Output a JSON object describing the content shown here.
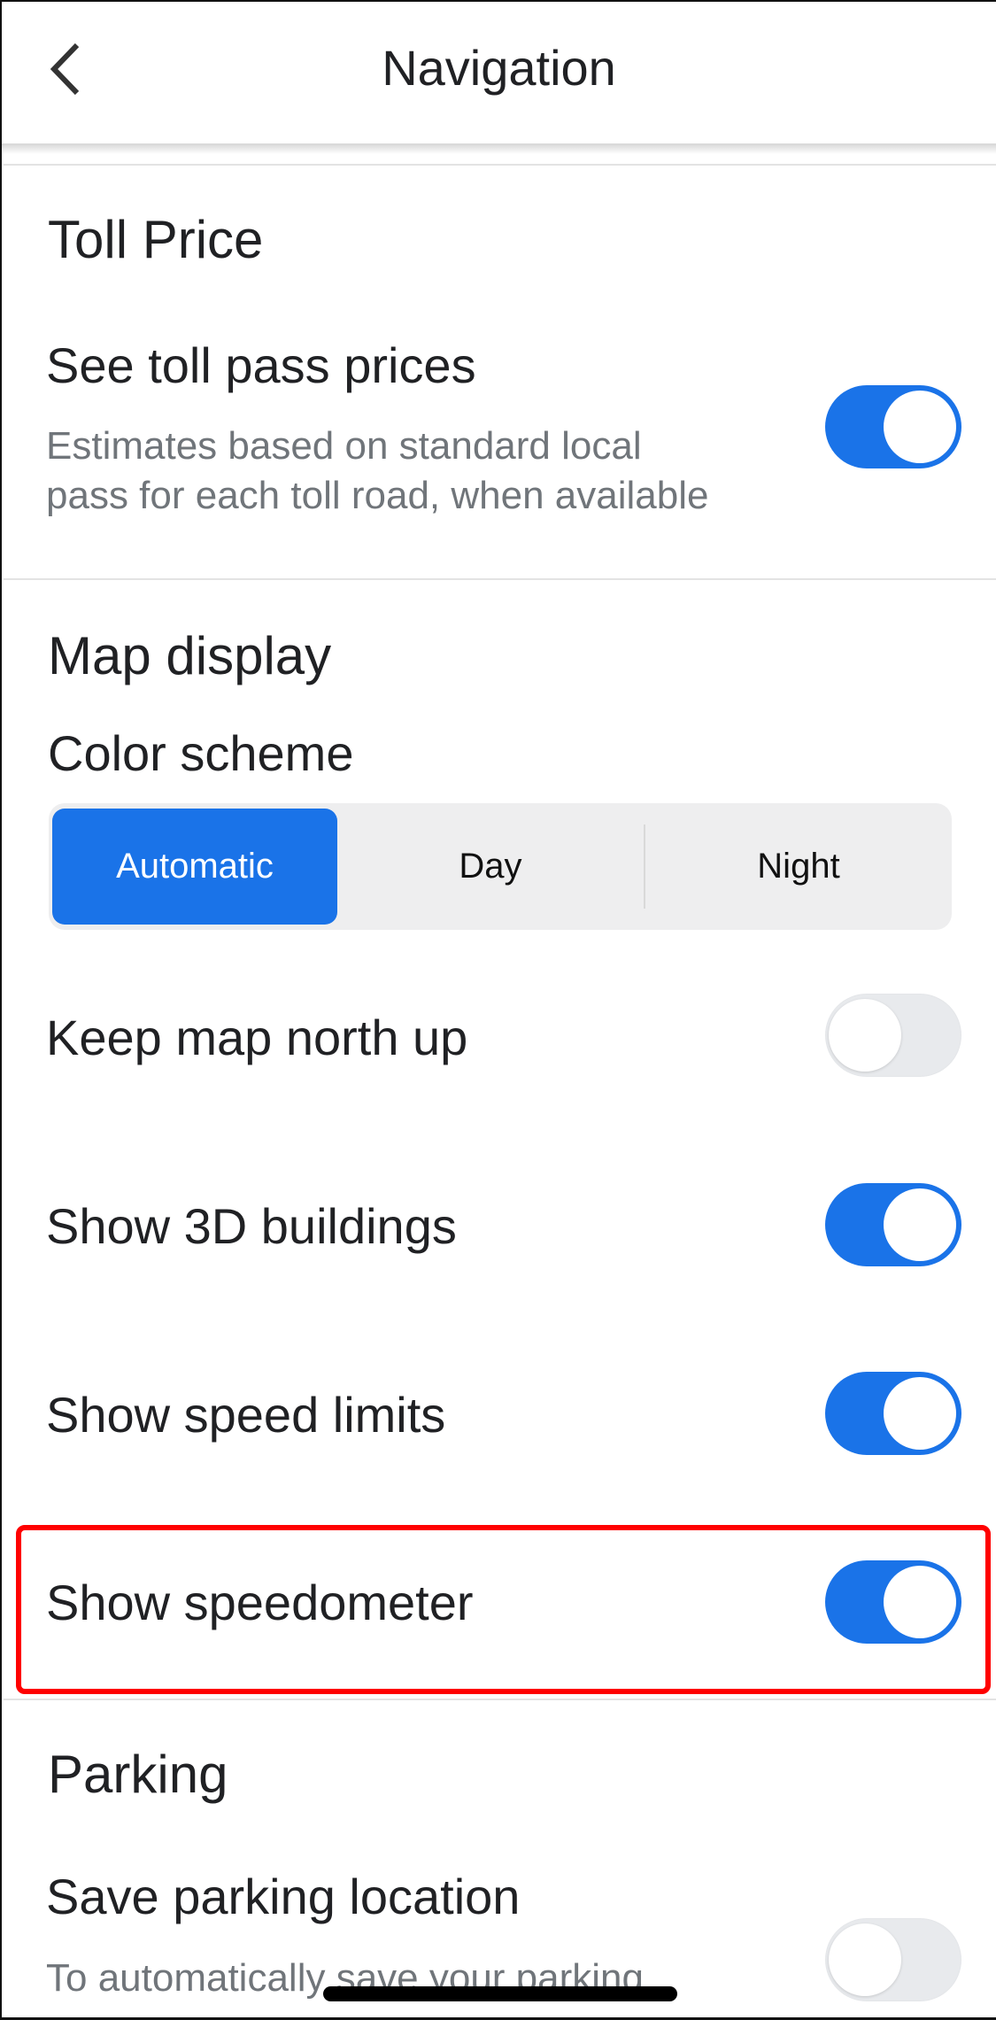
{
  "header": {
    "title": "Navigation",
    "back_icon": "chevron-left-icon"
  },
  "sections": {
    "toll_price": {
      "title": "Toll Price",
      "items": [
        {
          "label": "See toll pass prices",
          "description_line1": "Estimates based on standard local",
          "description_line2": "pass for each toll road, when available",
          "enabled": true
        }
      ]
    },
    "map_display": {
      "title": "Map display",
      "color_scheme": {
        "label": "Color scheme",
        "options": [
          "Automatic",
          "Day",
          "Night"
        ],
        "selected": "Automatic"
      },
      "items": [
        {
          "label": "Keep map north up",
          "enabled": false
        },
        {
          "label": "Show 3D buildings",
          "enabled": true
        },
        {
          "label": "Show speed limits",
          "enabled": true
        },
        {
          "label": "Show speedometer",
          "enabled": true,
          "highlighted": true
        }
      ]
    },
    "parking": {
      "title": "Parking",
      "items": [
        {
          "label": "Save parking location",
          "description_line1": "To automatically save your parking,",
          "enabled": false
        }
      ]
    }
  },
  "colors": {
    "accent": "#1a73e8",
    "toggle_off": "#e8eaed",
    "highlight": "#ff0000",
    "secondary_text": "#70757a"
  }
}
